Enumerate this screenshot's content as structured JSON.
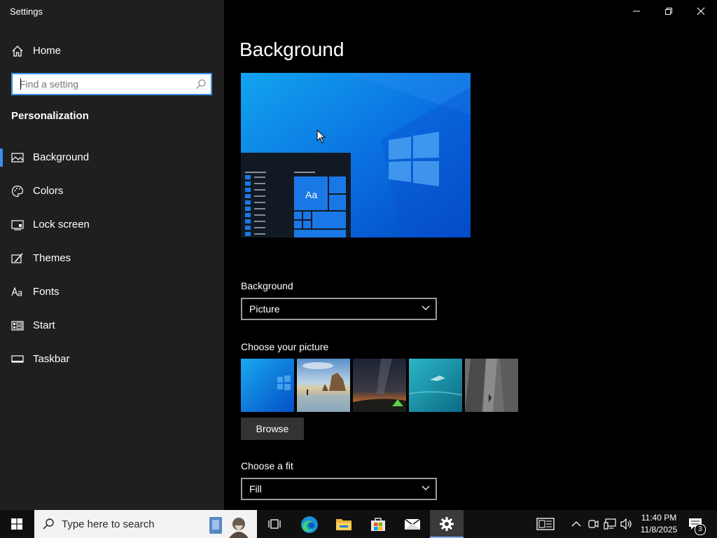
{
  "window": {
    "title": "Settings"
  },
  "sidebar": {
    "home_label": "Home",
    "search_placeholder": "Find a setting",
    "section_label": "Personalization",
    "items": [
      {
        "label": "Background",
        "icon": "picture-icon",
        "active": true
      },
      {
        "label": "Colors",
        "icon": "palette-icon"
      },
      {
        "label": "Lock screen",
        "icon": "lock-screen-icon"
      },
      {
        "label": "Themes",
        "icon": "themes-brush-icon"
      },
      {
        "label": "Fonts",
        "icon": "fonts-icon"
      },
      {
        "label": "Start",
        "icon": "start-tiles-icon"
      },
      {
        "label": "Taskbar",
        "icon": "taskbar-icon"
      }
    ]
  },
  "main": {
    "title": "Background",
    "preview_tile_text": "Aa",
    "background_label": "Background",
    "background_value": "Picture",
    "choose_picture_label": "Choose your picture",
    "pictures": [
      "windows-light-wallpaper",
      "beach-rocks-wallpaper",
      "night-sky-tent-wallpaper",
      "underwater-swimmer-wallpaper",
      "rock-cliff-wallpaper"
    ],
    "browse_label": "Browse",
    "fit_label": "Choose a fit",
    "fit_value": "Fill"
  },
  "taskbar": {
    "search_placeholder": "Type here to search",
    "time": "11:40 PM",
    "date": "11/8/2025",
    "notification_count": "3",
    "accent": "#7fb0ff"
  },
  "colors": {
    "accent": "#3b8eea",
    "sidebar_bg": "#1f1f1f",
    "main_bg": "#000000"
  }
}
